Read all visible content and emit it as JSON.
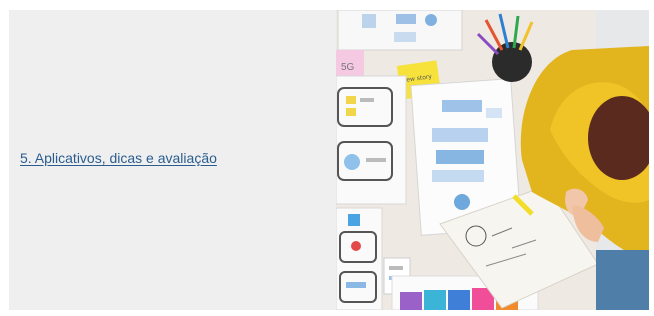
{
  "section": {
    "link_label": "5. Aplicativos, dicas e avaliação"
  },
  "image": {
    "sticky_note_pink": "5G",
    "sticky_note_yellow": "New story",
    "colors": {
      "panel_background": "#efefef",
      "link": "#2a5d8f",
      "shirt": "#e2b51f",
      "hair": "#5a2a1e",
      "table": "#eee9e3"
    }
  }
}
